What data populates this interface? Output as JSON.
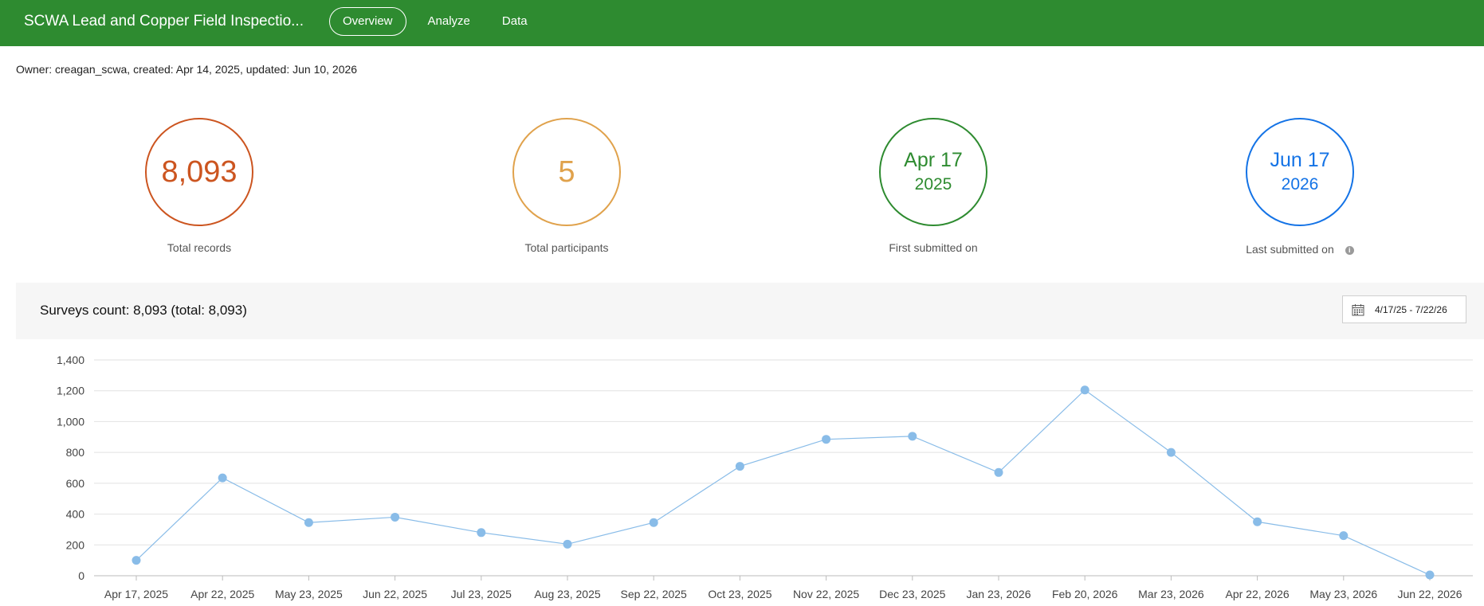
{
  "header": {
    "title": "SCWA Lead and Copper Field Inspectio...",
    "tabs": [
      {
        "label": "Overview",
        "active": true
      },
      {
        "label": "Analyze",
        "active": false
      },
      {
        "label": "Data",
        "active": false
      }
    ]
  },
  "meta": "Owner: creagan_scwa, created: Apr 14, 2025, updated: Jun 10, 2026",
  "stats": {
    "total_records": {
      "value": "8,093",
      "label": "Total records",
      "color": "#cc5520"
    },
    "total_participants": {
      "value": "5",
      "label": "Total participants",
      "color": "#e0a24c"
    },
    "first_submitted": {
      "date": "Apr 17",
      "year": "2025",
      "label": "First submitted on",
      "color": "#2e8b30"
    },
    "last_submitted": {
      "date": "Jun 17",
      "year": "2026",
      "label": "Last submitted on",
      "color": "#1473e6",
      "info_icon": "info-icon"
    }
  },
  "chart_header": {
    "title": "Surveys count: 8,093 (total: 8,093)",
    "date_range": "4/17/25 - 7/22/26",
    "date_icon": "calendar-icon"
  },
  "chart_data": {
    "type": "line",
    "categories": [
      "Apr 17, 2025",
      "Apr 22, 2025",
      "May 23, 2025",
      "Jun 22, 2025",
      "Jul 23, 2025",
      "Aug 23, 2025",
      "Sep 22, 2025",
      "Oct 23, 2025",
      "Nov 22, 2025",
      "Dec 23, 2025",
      "Jan 23, 2026",
      "Feb 20, 2026",
      "Mar 23, 2026",
      "Apr 22, 2026",
      "May 23, 2026",
      "Jun 22, 2026"
    ],
    "values": [
      100,
      635,
      345,
      380,
      280,
      205,
      345,
      710,
      885,
      905,
      670,
      1205,
      800,
      350,
      260,
      5
    ],
    "yticks": [
      "0",
      "200",
      "400",
      "600",
      "800",
      "1,000",
      "1,200",
      "1,400"
    ],
    "ylim": [
      0,
      1400
    ],
    "grid": true,
    "color": "#89bce8"
  }
}
